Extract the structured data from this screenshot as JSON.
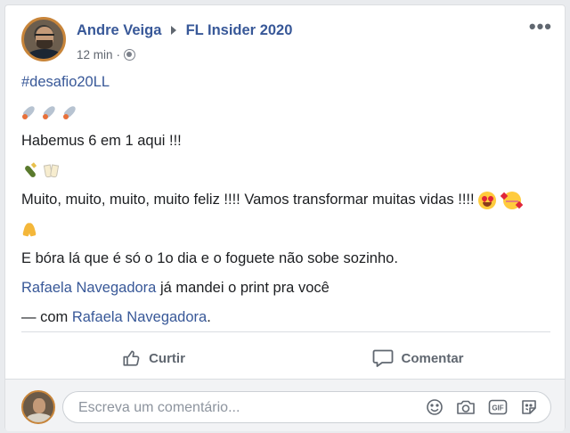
{
  "post": {
    "author": "Andre Veiga",
    "group": "FL Insider 2020",
    "time": "12 min",
    "dot": "·",
    "audience_icon": "group-icon",
    "more_icon": "more-options-icon",
    "more_glyph": "•••"
  },
  "content": {
    "hashtag": "#desafio20LL",
    "line_habemus": "Habemus 6 em 1 aqui !!!",
    "line_feliz": "Muito, muito, muito, muito feliz !!!! Vamos transformar muitas vidas !!!! ",
    "line_bora": "E bóra lá que é só o 1o dia e o foguete não sobe sozinho.",
    "mention_name": "Rafaela Navegadora",
    "mention_rest": " já mandei o print pra você",
    "with_prefix": "— com ",
    "with_name": "Rafaela Navegadora",
    "with_suffix": "."
  },
  "actions": {
    "like_label": "Curtir",
    "comment_label": "Comentar"
  },
  "comment": {
    "placeholder": "Escreva um comentário...",
    "gif_label": "GIF"
  },
  "colors": {
    "link": "#385898",
    "meta": "#616770",
    "accent_border": "#c8853a"
  }
}
